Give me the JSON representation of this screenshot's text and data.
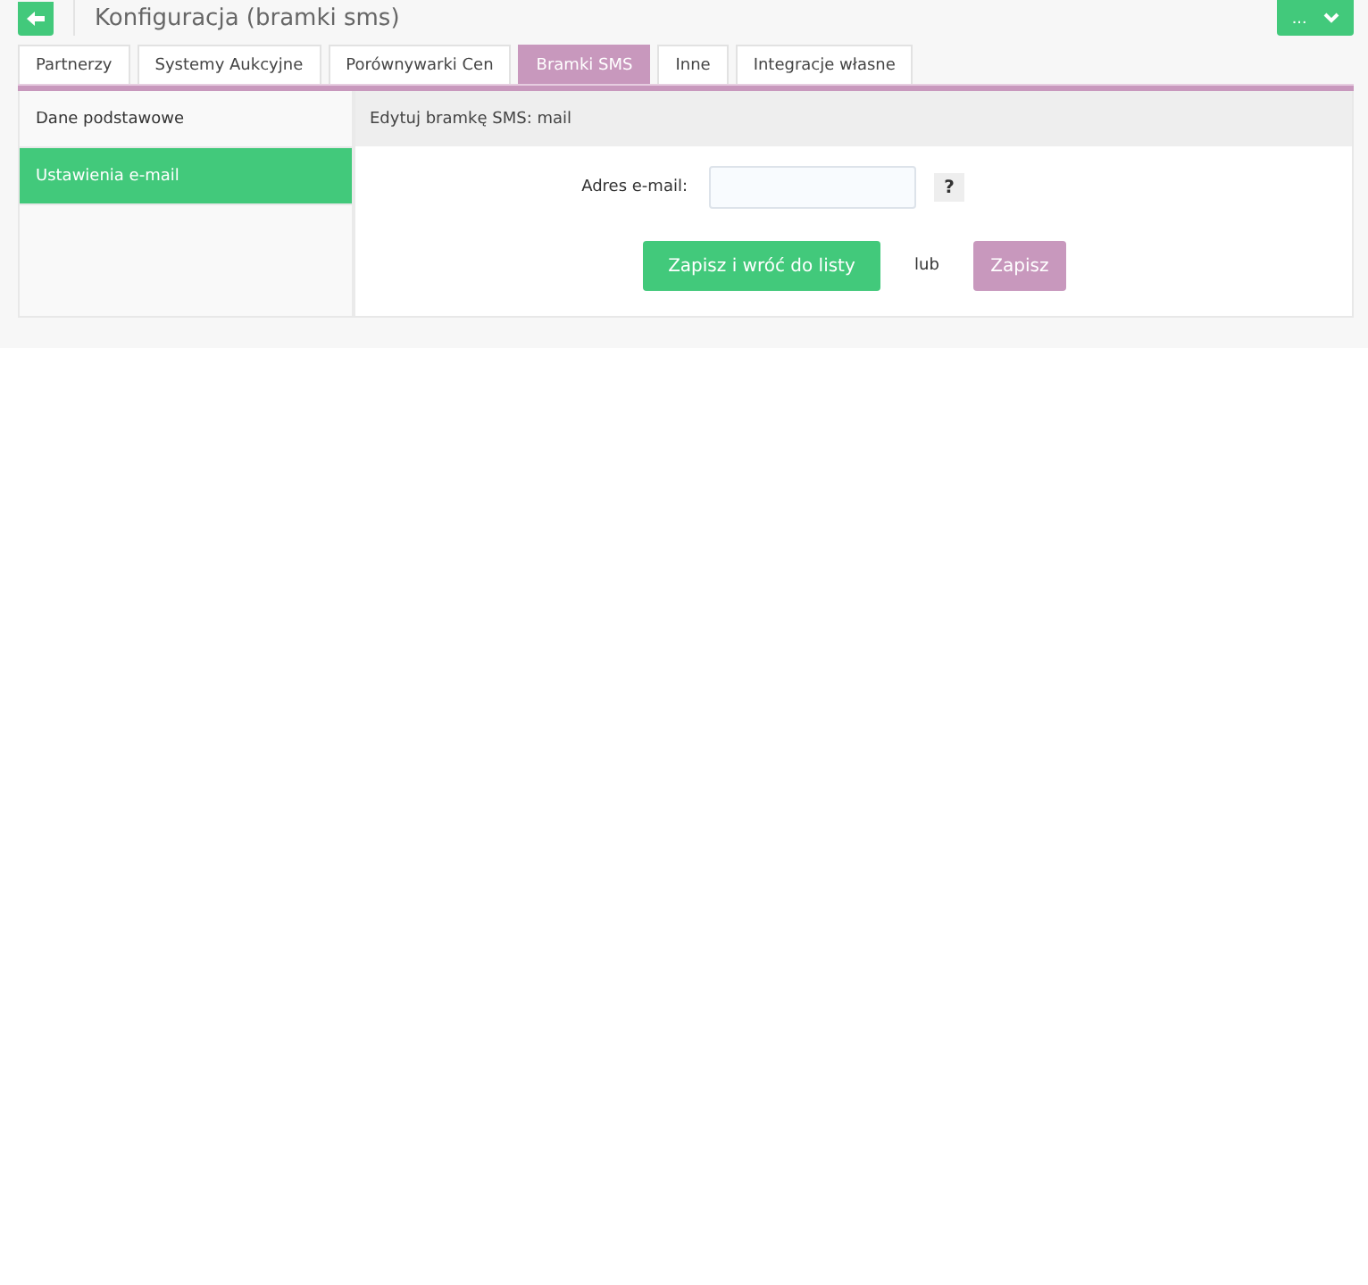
{
  "header": {
    "title": "Konfiguracja (bramki sms)",
    "menu_button": "..."
  },
  "tabs": [
    {
      "label": "Partnerzy",
      "selected": false
    },
    {
      "label": "Systemy Aukcyjne",
      "selected": false
    },
    {
      "label": "Porównywarki Cen",
      "selected": false
    },
    {
      "label": "Bramki SMS",
      "selected": true
    },
    {
      "label": "Inne",
      "selected": false
    },
    {
      "label": "Integracje własne",
      "selected": false
    }
  ],
  "sidebar": {
    "items": [
      {
        "label": "Dane podstawowe",
        "selected": false
      },
      {
        "label": "Ustawienia e-mail",
        "selected": true
      }
    ]
  },
  "panel": {
    "title": "Edytuj bramkę SMS: mail",
    "fields": [
      {
        "label": "Adres e-mail:",
        "help": "?"
      }
    ],
    "buttons": [
      {
        "label": "Zapisz i wróć do listy",
        "kind": "primary"
      },
      {
        "label": "lub",
        "kind": "separator"
      },
      {
        "label": "Zapisz",
        "kind": "secondary"
      }
    ]
  }
}
